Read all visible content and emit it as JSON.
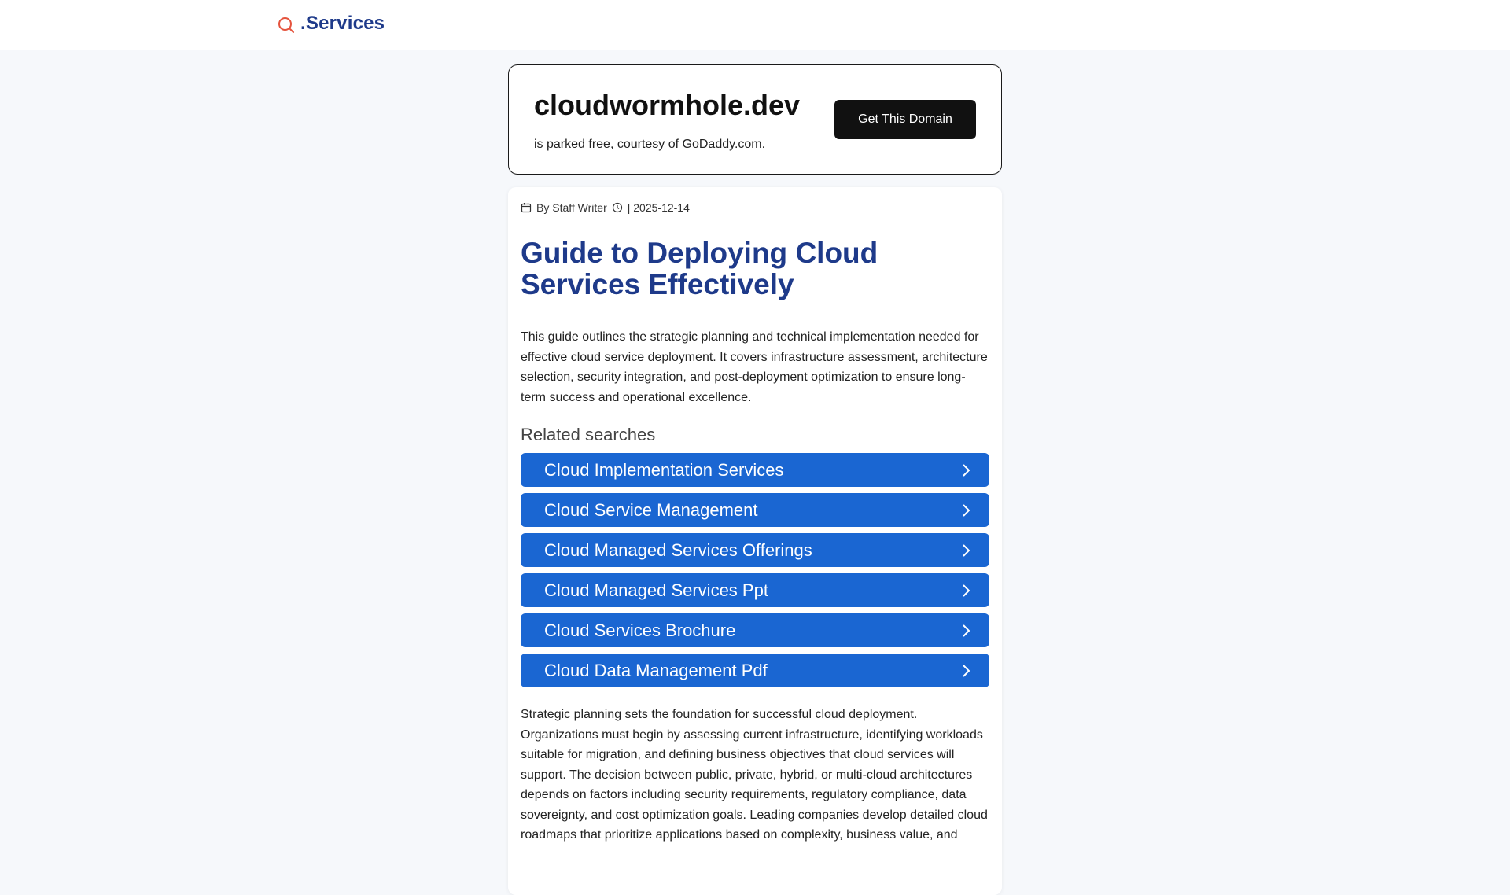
{
  "header": {
    "brand": ".Services",
    "colors": {
      "brand": "#1e3a8a",
      "search_icon": "#e5533d"
    }
  },
  "domain_card": {
    "name": "cloudwormhole.dev",
    "subtitle": "is parked free, courtesy of GoDaddy.com.",
    "cta_label": "Get This Domain"
  },
  "article": {
    "author": "By Staff Writer",
    "date": "| 2025-12-14",
    "title": "Guide to Deploying Cloud Services Effectively",
    "intro": "This guide outlines the strategic planning and technical implementation needed for effective cloud service deployment. It covers infrastructure assessment, architecture selection, security integration, and post-deployment optimization to ensure long-term success and operational excellence.",
    "related_heading": "Related searches",
    "related": [
      {
        "label": "Cloud Implementation Services"
      },
      {
        "label": "Cloud Service Management"
      },
      {
        "label": "Cloud Managed Services Offerings"
      },
      {
        "label": "Cloud Managed Services Ppt"
      },
      {
        "label": "Cloud Services Brochure"
      },
      {
        "label": "Cloud Data Management Pdf"
      }
    ],
    "body": "Strategic planning sets the foundation for successful cloud deployment. Organizations must begin by assessing current infrastructure, identifying workloads suitable for migration, and defining business objectives that cloud services will support. The decision between public, private, hybrid, or multi-cloud architectures depends on factors including security requirements, regulatory compliance, data sovereignty, and cost optimization goals. Leading companies develop detailed cloud roadmaps that prioritize applications based on complexity, business value, and"
  }
}
